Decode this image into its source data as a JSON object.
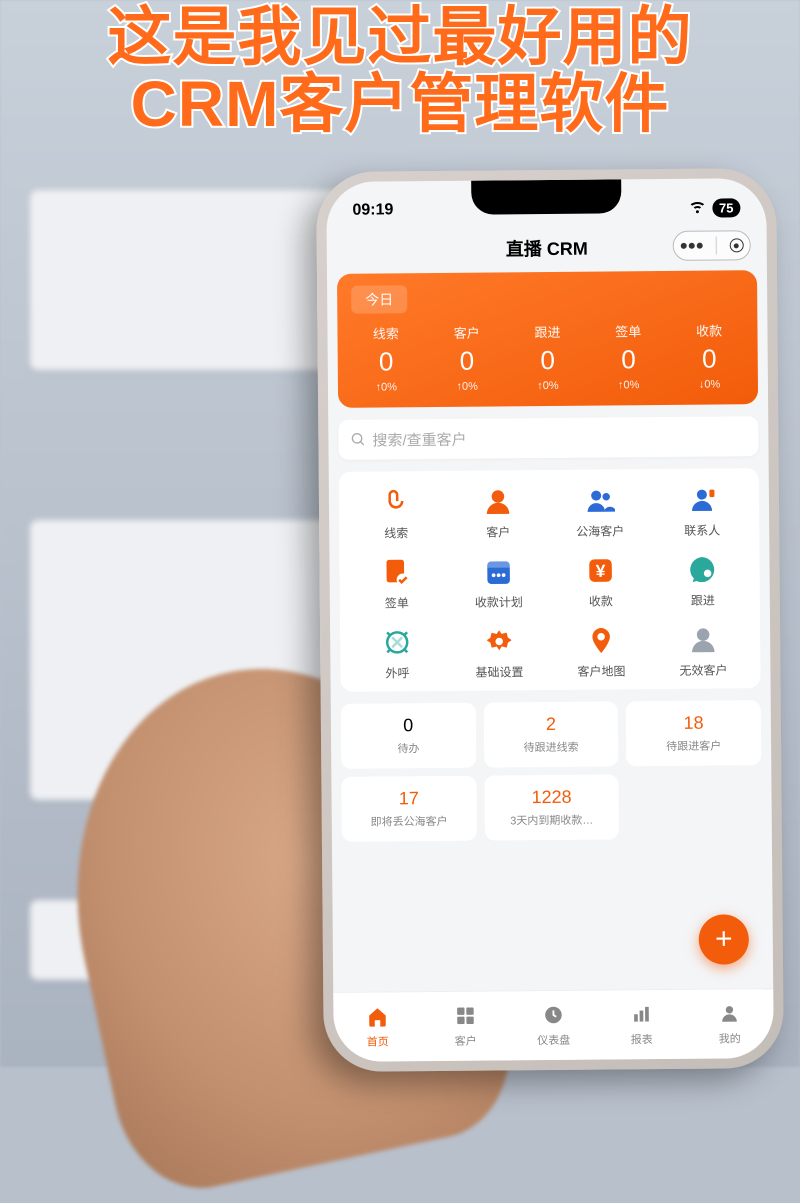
{
  "caption": {
    "line1": "这是我见过最好用的",
    "line2": "CRM客户管理软件"
  },
  "status": {
    "time": "09:19",
    "battery": "75"
  },
  "title": "直播 CRM",
  "stats": {
    "today_label": "今日",
    "items": [
      {
        "label": "线索",
        "value": "0",
        "delta": "↑0%"
      },
      {
        "label": "客户",
        "value": "0",
        "delta": "↑0%"
      },
      {
        "label": "跟进",
        "value": "0",
        "delta": "↑0%"
      },
      {
        "label": "签单",
        "value": "0",
        "delta": "↑0%"
      },
      {
        "label": "收款",
        "value": "0",
        "delta": "↓0%"
      }
    ]
  },
  "search": {
    "placeholder": "搜索/查重客户"
  },
  "apps": [
    {
      "label": "线索",
      "icon": "lead-icon",
      "color": "#f25c0a"
    },
    {
      "label": "客户",
      "icon": "customer-icon",
      "color": "#f25c0a"
    },
    {
      "label": "公海客户",
      "icon": "public-icon",
      "color": "#2b6bd6"
    },
    {
      "label": "联系人",
      "icon": "contact-icon",
      "color": "#2b6bd6"
    },
    {
      "label": "签单",
      "icon": "contract-icon",
      "color": "#f25c0a"
    },
    {
      "label": "收款计划",
      "icon": "plan-icon",
      "color": "#2b6bd6"
    },
    {
      "label": "收款",
      "icon": "payment-icon",
      "color": "#f25c0a"
    },
    {
      "label": "跟进",
      "icon": "follow-icon",
      "color": "#2aa89c"
    },
    {
      "label": "外呼",
      "icon": "call-icon",
      "color": "#2aa89c"
    },
    {
      "label": "基础设置",
      "icon": "settings-icon",
      "color": "#f25c0a"
    },
    {
      "label": "客户地图",
      "icon": "map-icon",
      "color": "#f25c0a"
    },
    {
      "label": "无效客户",
      "icon": "invalid-icon",
      "color": "#9aa3ae"
    }
  ],
  "tiles": [
    {
      "value": "0",
      "label": "待办",
      "accent": false
    },
    {
      "value": "2",
      "label": "待跟进线索",
      "accent": true
    },
    {
      "value": "18",
      "label": "待跟进客户",
      "accent": true
    },
    {
      "value": "17",
      "label": "即将丢公海客户",
      "accent": true
    },
    {
      "value": "1228",
      "label": "3天内到期收款…",
      "accent": true
    }
  ],
  "nav": [
    {
      "label": "首页",
      "active": true
    },
    {
      "label": "客户",
      "active": false
    },
    {
      "label": "仪表盘",
      "active": false
    },
    {
      "label": "报表",
      "active": false
    },
    {
      "label": "我的",
      "active": false
    }
  ],
  "colors": {
    "primary": "#f25c0a",
    "blue": "#2b6bd6",
    "teal": "#2aa89c",
    "gray": "#9aa3ae"
  }
}
